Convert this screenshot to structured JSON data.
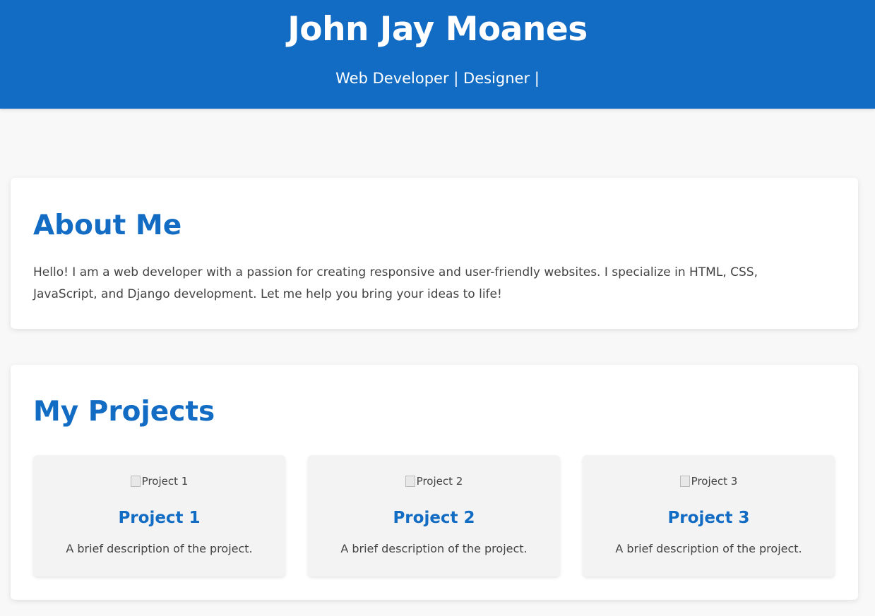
{
  "header": {
    "name": "John Jay Moanes",
    "subtitle": "Web Developer | Designer |"
  },
  "about": {
    "title": "About Me",
    "text": "Hello! I am a web developer with a passion for creating responsive and user-friendly websites. I specialize in HTML, CSS, JavaScript, and Django development. Let me help you bring your ideas to life!"
  },
  "projects": {
    "title": "My Projects",
    "items": [
      {
        "image_alt": "Project 1",
        "title": "Project 1",
        "description": "A brief description of the project."
      },
      {
        "image_alt": "Project 2",
        "title": "Project 2",
        "description": "A brief description of the project."
      },
      {
        "image_alt": "Project 3",
        "title": "Project 3",
        "description": "A brief description of the project."
      }
    ]
  },
  "colors": {
    "primary": "#126cc4",
    "background": "#f8f8f8",
    "card": "#ffffff",
    "project_card": "#f3f3f3",
    "text": "#444444"
  }
}
